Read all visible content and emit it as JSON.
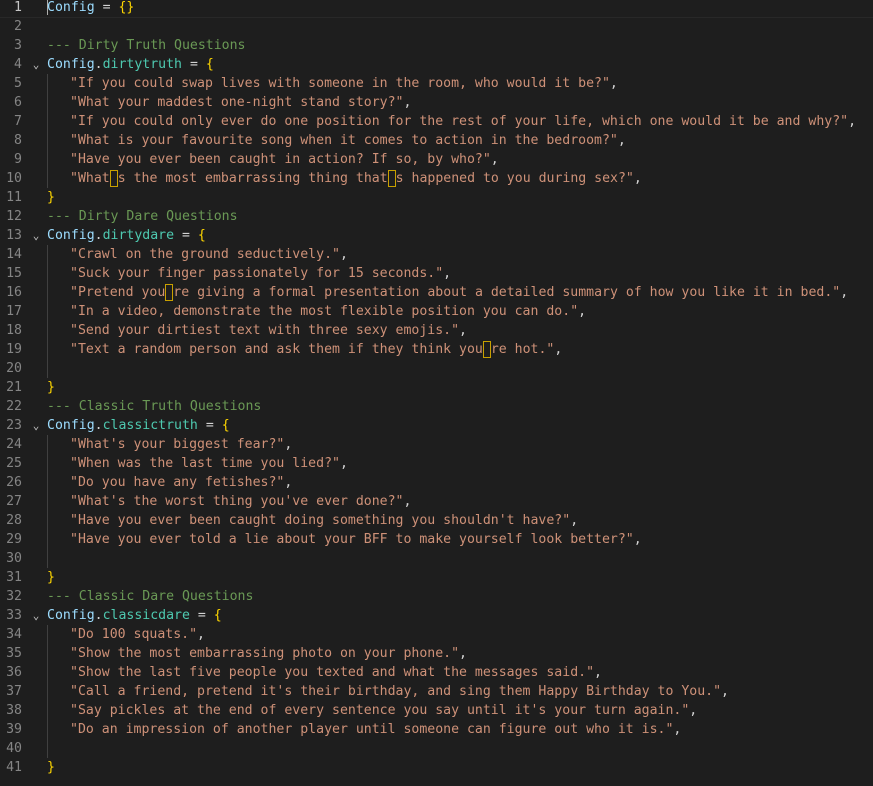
{
  "editor": {
    "lines": [
      {
        "n": "1",
        "tokens": [
          {
            "t": "Config",
            "c": "var"
          },
          {
            "t": " = ",
            "c": "op"
          },
          {
            "t": "{}",
            "c": "brace"
          }
        ]
      },
      {
        "n": "2",
        "tokens": []
      },
      {
        "n": "3",
        "tokens": [
          {
            "t": "--- Dirty Truth Questions",
            "c": "comment"
          }
        ]
      },
      {
        "n": "4",
        "fold": true,
        "tokens": [
          {
            "t": "Config",
            "c": "var"
          },
          {
            "t": ".",
            "c": "op"
          },
          {
            "t": "dirtytruth",
            "c": "prop"
          },
          {
            "t": " = ",
            "c": "op"
          },
          {
            "t": "{",
            "c": "brace"
          }
        ]
      },
      {
        "n": "5",
        "indent": true,
        "tokens": [
          {
            "t": "\"If you could swap lives with someone in the room, who would it be?\"",
            "c": "str"
          },
          {
            "t": ",",
            "c": "punct"
          }
        ]
      },
      {
        "n": "6",
        "indent": true,
        "tokens": [
          {
            "t": "\"What your maddest one-night stand story?\"",
            "c": "str"
          },
          {
            "t": ",",
            "c": "punct"
          }
        ]
      },
      {
        "n": "7",
        "indent": true,
        "tokens": [
          {
            "t": "\"If you could only ever do one position for the rest of your life, which one would it be and why?\"",
            "c": "str"
          },
          {
            "t": ",",
            "c": "punct"
          }
        ]
      },
      {
        "n": "8",
        "indent": true,
        "tokens": [
          {
            "t": "\"What is your favourite song when it comes to action in the bedroom?\"",
            "c": "str"
          },
          {
            "t": ",",
            "c": "punct"
          }
        ]
      },
      {
        "n": "9",
        "indent": true,
        "tokens": [
          {
            "t": "\"Have you ever been caught in action? If so, by who?\"",
            "c": "str"
          },
          {
            "t": ",",
            "c": "punct"
          }
        ]
      },
      {
        "n": "10",
        "indent": true,
        "tokens": [
          {
            "t": "\"What",
            "c": "str"
          },
          {
            "t": "",
            "c": "uchar"
          },
          {
            "t": "s the most embarrassing thing that",
            "c": "str"
          },
          {
            "t": "",
            "c": "uchar"
          },
          {
            "t": "s happened to you during sex?\"",
            "c": "str"
          },
          {
            "t": ",",
            "c": "punct"
          }
        ]
      },
      {
        "n": "11",
        "tokens": [
          {
            "t": "}",
            "c": "brace"
          }
        ]
      },
      {
        "n": "12",
        "tokens": [
          {
            "t": "--- Dirty Dare Questions",
            "c": "comment"
          }
        ]
      },
      {
        "n": "13",
        "fold": true,
        "tokens": [
          {
            "t": "Config",
            "c": "var"
          },
          {
            "t": ".",
            "c": "op"
          },
          {
            "t": "dirtydare",
            "c": "prop"
          },
          {
            "t": " = ",
            "c": "op"
          },
          {
            "t": "{",
            "c": "brace"
          }
        ]
      },
      {
        "n": "14",
        "indent": true,
        "tokens": [
          {
            "t": "\"Crawl on the ground seductively.\"",
            "c": "str"
          },
          {
            "t": ",",
            "c": "punct"
          }
        ]
      },
      {
        "n": "15",
        "indent": true,
        "tokens": [
          {
            "t": "\"Suck your finger passionately for 15 seconds.\"",
            "c": "str"
          },
          {
            "t": ",",
            "c": "punct"
          }
        ]
      },
      {
        "n": "16",
        "indent": true,
        "tokens": [
          {
            "t": "\"Pretend you",
            "c": "str"
          },
          {
            "t": "",
            "c": "uchar"
          },
          {
            "t": "re giving a formal presentation about a detailed summary of how you like it in bed.\"",
            "c": "str"
          },
          {
            "t": ",",
            "c": "punct"
          }
        ]
      },
      {
        "n": "17",
        "indent": true,
        "tokens": [
          {
            "t": "\"In a video, demonstrate the most flexible position you can do.\"",
            "c": "str"
          },
          {
            "t": ",",
            "c": "punct"
          }
        ]
      },
      {
        "n": "18",
        "indent": true,
        "tokens": [
          {
            "t": "\"Send your dirtiest text with three sexy emojis.\"",
            "c": "str"
          },
          {
            "t": ",",
            "c": "punct"
          }
        ]
      },
      {
        "n": "19",
        "indent": true,
        "tokens": [
          {
            "t": "\"Text a random person and ask them if they think you",
            "c": "str"
          },
          {
            "t": "",
            "c": "uchar"
          },
          {
            "t": "re hot.\"",
            "c": "str"
          },
          {
            "t": ",",
            "c": "punct"
          }
        ]
      },
      {
        "n": "20",
        "indent": true,
        "tokens": []
      },
      {
        "n": "21",
        "tokens": [
          {
            "t": "}",
            "c": "brace"
          }
        ]
      },
      {
        "n": "22",
        "tokens": [
          {
            "t": "--- Classic Truth Questions",
            "c": "comment"
          }
        ]
      },
      {
        "n": "23",
        "fold": true,
        "tokens": [
          {
            "t": "Config",
            "c": "var"
          },
          {
            "t": ".",
            "c": "op"
          },
          {
            "t": "classictruth",
            "c": "prop"
          },
          {
            "t": " = ",
            "c": "op"
          },
          {
            "t": "{",
            "c": "brace"
          }
        ]
      },
      {
        "n": "24",
        "indent": true,
        "tokens": [
          {
            "t": "\"What's your biggest fear?\"",
            "c": "str"
          },
          {
            "t": ",",
            "c": "punct"
          }
        ]
      },
      {
        "n": "25",
        "indent": true,
        "tokens": [
          {
            "t": "\"When was the last time you lied?\"",
            "c": "str"
          },
          {
            "t": ",",
            "c": "punct"
          }
        ]
      },
      {
        "n": "26",
        "indent": true,
        "tokens": [
          {
            "t": "\"Do you have any fetishes?\"",
            "c": "str"
          },
          {
            "t": ",",
            "c": "punct"
          }
        ]
      },
      {
        "n": "27",
        "indent": true,
        "tokens": [
          {
            "t": "\"What's the worst thing you've ever done?\"",
            "c": "str"
          },
          {
            "t": ",",
            "c": "punct"
          }
        ]
      },
      {
        "n": "28",
        "indent": true,
        "tokens": [
          {
            "t": "\"Have you ever been caught doing something you shouldn't have?\"",
            "c": "str"
          },
          {
            "t": ",",
            "c": "punct"
          }
        ]
      },
      {
        "n": "29",
        "indent": true,
        "tokens": [
          {
            "t": "\"Have you ever told a lie about your BFF to make yourself look better?\"",
            "c": "str"
          },
          {
            "t": ",",
            "c": "punct"
          }
        ]
      },
      {
        "n": "30",
        "indent": true,
        "tokens": []
      },
      {
        "n": "31",
        "tokens": [
          {
            "t": "}",
            "c": "brace"
          }
        ]
      },
      {
        "n": "32",
        "tokens": [
          {
            "t": "--- Classic Dare Questions",
            "c": "comment"
          }
        ]
      },
      {
        "n": "33",
        "fold": true,
        "tokens": [
          {
            "t": "Config",
            "c": "var"
          },
          {
            "t": ".",
            "c": "op"
          },
          {
            "t": "classicdare",
            "c": "prop"
          },
          {
            "t": " = ",
            "c": "op"
          },
          {
            "t": "{",
            "c": "brace"
          }
        ]
      },
      {
        "n": "34",
        "indent": true,
        "tokens": [
          {
            "t": "\"Do 100 squats.\"",
            "c": "str"
          },
          {
            "t": ",",
            "c": "punct"
          }
        ]
      },
      {
        "n": "35",
        "indent": true,
        "tokens": [
          {
            "t": "\"Show the most embarrassing photo on your phone.\"",
            "c": "str"
          },
          {
            "t": ",",
            "c": "punct"
          }
        ]
      },
      {
        "n": "36",
        "indent": true,
        "tokens": [
          {
            "t": "\"Show the last five people you texted and what the messages said.\"",
            "c": "str"
          },
          {
            "t": ",",
            "c": "punct"
          }
        ]
      },
      {
        "n": "37",
        "indent": true,
        "tokens": [
          {
            "t": "\"Call a friend, pretend it's their birthday, and sing them Happy Birthday to You.\"",
            "c": "str"
          },
          {
            "t": ",",
            "c": "punct"
          }
        ]
      },
      {
        "n": "38",
        "indent": true,
        "tokens": [
          {
            "t": "\"Say pickles at the end of every sentence you say until it's your turn again.\"",
            "c": "str"
          },
          {
            "t": ",",
            "c": "punct"
          }
        ]
      },
      {
        "n": "39",
        "indent": true,
        "tokens": [
          {
            "t": "\"Do an impression of another player until someone can figure out who it is.\"",
            "c": "str"
          },
          {
            "t": ",",
            "c": "punct"
          }
        ]
      },
      {
        "n": "40",
        "indent": true,
        "tokens": []
      },
      {
        "n": "41",
        "tokens": [
          {
            "t": "}",
            "c": "brace"
          }
        ]
      }
    ],
    "current_line": "1",
    "fold_glyph": "⌄",
    "colors": {
      "background": "#1e1e1e",
      "comment": "#6a9955",
      "variable": "#9cdcfe",
      "property": "#4ec9b0",
      "string": "#ce9178",
      "brace": "#ffd700",
      "line_number": "#858585"
    }
  }
}
